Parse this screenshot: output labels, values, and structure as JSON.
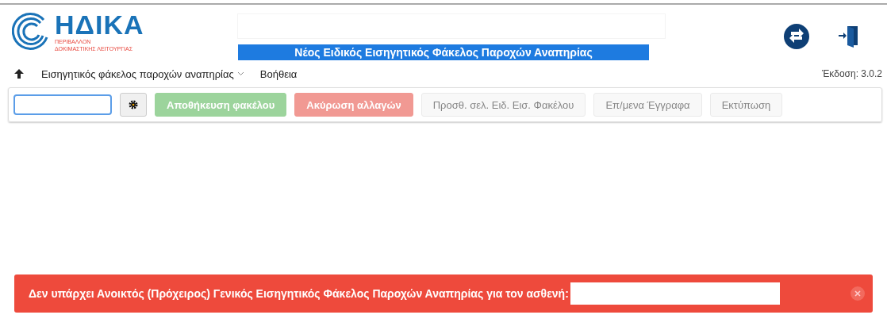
{
  "header": {
    "logo": {
      "name": "ΗΔΙΚΑ",
      "line_1": "ΠΕΡΙΒΑΛΛΟΝ",
      "line_2": "ΔΟΚΙΜΑΣΤΙΚΗΣ ΛΕΙΤΟΥΡΓΙΑΣ"
    },
    "title": "Νέος Ειδικός Εισηγητικός Φάκελος Παροχών Αναπηρίας"
  },
  "nav": {
    "items": [
      {
        "label": "Εισηγητικός φάκελος παροχών αναπηρίας",
        "dropdown": true
      },
      {
        "label": "Βοήθεια",
        "dropdown": false
      }
    ],
    "version": "Έκδοση: 3.0.2"
  },
  "toolbar": {
    "buttons": [
      {
        "label": "Αποθήκευση φακέλου",
        "kind": "success",
        "disabled": true
      },
      {
        "label": "Ακύρωση αλλαγών",
        "kind": "danger",
        "disabled": true
      },
      {
        "label": "Προσθ. σελ. Ειδ. Εισ. Φακέλου",
        "kind": "default",
        "disabled": true
      },
      {
        "label": "Επ/μενα Έγγραφα",
        "kind": "default",
        "disabled": true
      },
      {
        "label": "Εκτύπωση",
        "kind": "default",
        "disabled": true
      }
    ]
  },
  "alert": {
    "message": "Δεν υπάρχει Ανοικτός (Πρόχειρος) Γενικός Εισηγητικός Φάκελος Παροχών Αναπηρίας για τον ασθενή:"
  }
}
